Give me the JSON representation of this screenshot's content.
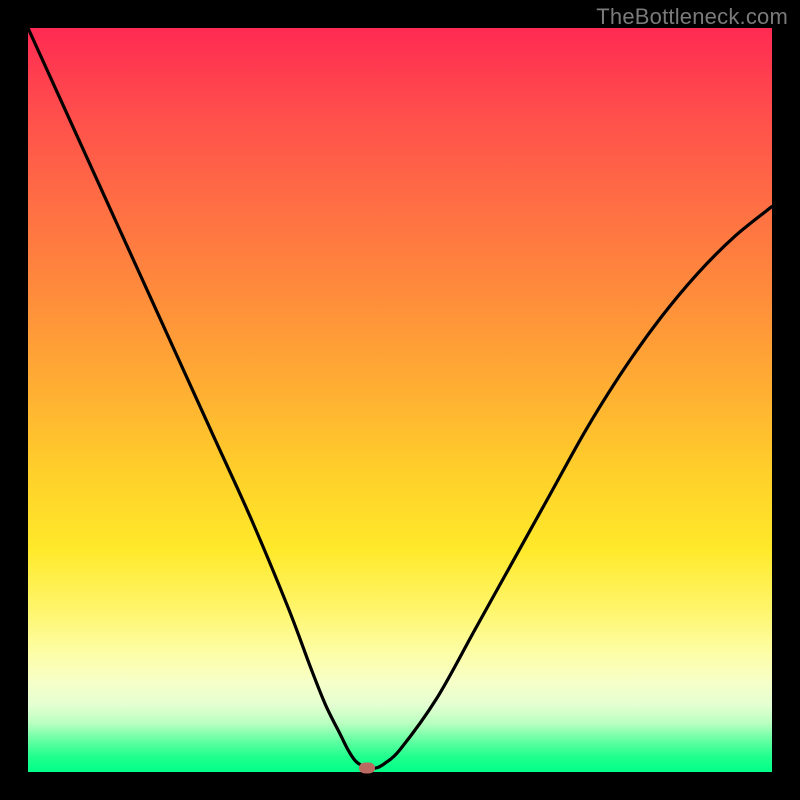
{
  "watermark": "TheBottleneck.com",
  "chart_data": {
    "type": "line",
    "title": "",
    "xlabel": "",
    "ylabel": "",
    "xlim": [
      0,
      100
    ],
    "ylim": [
      0,
      100
    ],
    "x": [
      0,
      5,
      10,
      15,
      20,
      25,
      30,
      35,
      38,
      40,
      42,
      43,
      44,
      45,
      46,
      47,
      48,
      50,
      55,
      60,
      65,
      70,
      75,
      80,
      85,
      90,
      95,
      100
    ],
    "values": [
      100,
      89,
      78,
      67,
      56,
      45,
      34,
      22,
      14,
      9,
      5,
      3,
      1.5,
      0.8,
      0.5,
      0.6,
      1.2,
      3,
      10,
      19,
      28,
      37,
      46,
      54,
      61,
      67,
      72,
      76
    ],
    "minimum": {
      "x": 45.5,
      "y": 0.5
    },
    "colors": {
      "curve": "#000000",
      "marker": "#ba6a60",
      "gradient_top": "#ff2a52",
      "gradient_bottom": "#00ff88"
    }
  }
}
